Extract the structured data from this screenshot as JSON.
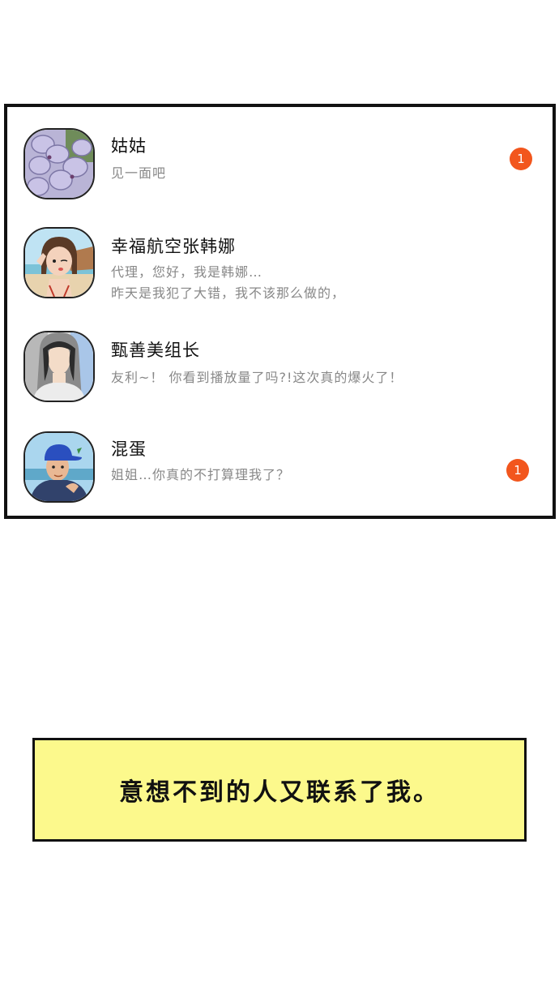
{
  "chats": [
    {
      "name": "姑姑",
      "preview_lines": [
        "见一面吧"
      ],
      "badge": "1",
      "avatar_icon": "lilac-flower-avatar"
    },
    {
      "name": "幸福航空张韩娜",
      "preview_lines": [
        "代理，您好，我是韩娜…",
        "昨天是我犯了大错，我不该那么做的，"
      ],
      "badge": "",
      "avatar_icon": "woman-beach-avatar"
    },
    {
      "name": "甄善美组长",
      "preview_lines": [
        "友利~！ 你看到播放量了吗?!这次真的爆火了！"
      ],
      "badge": "",
      "avatar_icon": "woman-silhouette-avatar"
    },
    {
      "name": "混蛋",
      "preview_lines": [
        "姐姐…你真的不打算理我了？"
      ],
      "badge": "1",
      "avatar_icon": "man-cap-avatar"
    }
  ],
  "caption": "意想不到的人又联系了我。",
  "colors": {
    "badge": "#f2561d",
    "caption_bg": "#fcf98c",
    "preview_text": "#888888"
  }
}
